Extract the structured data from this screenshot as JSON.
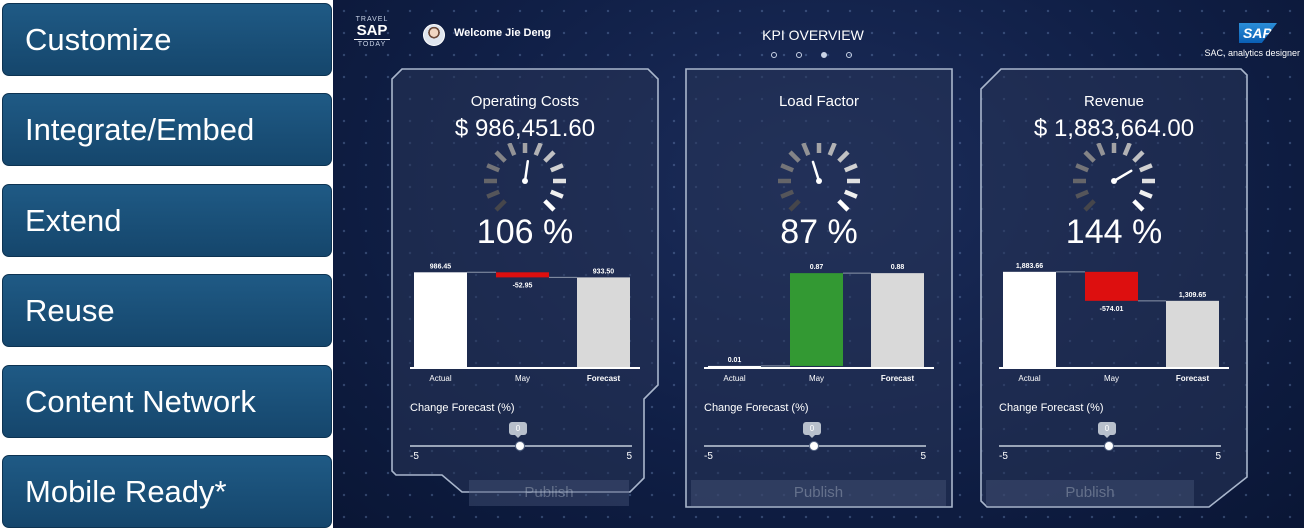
{
  "sidebar": {
    "items": [
      {
        "label": "Customize"
      },
      {
        "label": "Integrate/Embed"
      },
      {
        "label": "Extend"
      },
      {
        "label": "Reuse"
      },
      {
        "label": "Content Network"
      },
      {
        "label": "Mobile Ready*"
      }
    ]
  },
  "header": {
    "logo_top": "TRAVEL",
    "logo_main": "SAP",
    "logo_bottom": "TODAY",
    "welcome": "Welcome Jie Deng",
    "title": "KPI OVERVIEW",
    "page_count": 4,
    "active_page": 3,
    "brand": "SAP",
    "brand_subtitle": "SAC, analytics designer"
  },
  "colors": {
    "negative": "#dd0f0f",
    "positive": "#339933",
    "actual": "#ffffff",
    "forecast": "#d9d9d9"
  },
  "cards": [
    {
      "title": "Operating Costs",
      "amount": "$ 986,451.60",
      "percent": "106 %",
      "gauge_fraction": 0.53,
      "change_label": "Change Forecast (%)",
      "slider": {
        "value": "0",
        "min": "-5",
        "max": "5"
      },
      "publish": "Publish",
      "chart_data": {
        "type": "bar",
        "categories": [
          "Actual",
          "May",
          "Forecast"
        ],
        "values": [
          986.45,
          -52.95,
          933.5
        ],
        "labels": [
          "986.45",
          "-52.95",
          "933.50"
        ],
        "ylim": [
          0,
          1000
        ]
      }
    },
    {
      "title": "Load Factor",
      "amount": "",
      "percent": "87 %",
      "gauge_fraction": 0.435,
      "change_label": "Change Forecast (%)",
      "slider": {
        "value": "0",
        "min": "-5",
        "max": "5"
      },
      "publish": "Publish",
      "chart_data": {
        "type": "bar",
        "categories": [
          "Actual",
          "May",
          "Forecast"
        ],
        "values": [
          0.01,
          0.87,
          0.88
        ],
        "labels": [
          "0.01",
          "0.87",
          "0.88"
        ],
        "ylim": [
          0,
          0.9
        ]
      }
    },
    {
      "title": "Revenue",
      "amount": "$ 1,883,664.00",
      "percent": "144 %",
      "gauge_fraction": 0.72,
      "change_label": "Change Forecast (%)",
      "slider": {
        "value": "0",
        "min": "-5",
        "max": "5"
      },
      "publish": "Publish",
      "chart_data": {
        "type": "bar",
        "categories": [
          "Actual",
          "May",
          "Forecast"
        ],
        "values": [
          1883.66,
          -574.01,
          1309.65
        ],
        "labels": [
          "1,883.66",
          "-574.01",
          "1,309.65"
        ],
        "ylim": [
          0,
          1900
        ]
      }
    }
  ]
}
